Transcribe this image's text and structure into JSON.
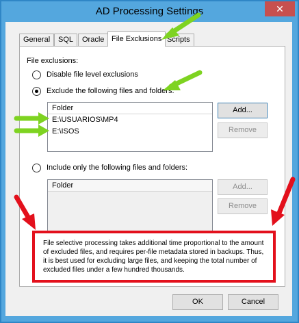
{
  "window": {
    "title": "AD Processing Settings",
    "close_glyph": "✕"
  },
  "tabs": [
    {
      "label": "General"
    },
    {
      "label": "SQL"
    },
    {
      "label": "Oracle"
    },
    {
      "label": "File Exclusions"
    },
    {
      "label": "Scripts"
    }
  ],
  "panel": {
    "group_label": "File exclusions:",
    "option_disable": "Disable file level exclusions",
    "option_exclude": "Exclude the following files and folders:",
    "option_include": "Include only the following files and folders:",
    "selected_option": "exclude",
    "exclude_list": {
      "header": "Folder",
      "rows": [
        "E:\\USUARIOS\\MP4",
        "E:\\ISOS"
      ]
    },
    "include_list": {
      "header": "Folder"
    },
    "add_label": "Add...",
    "remove_label": "Remove"
  },
  "note": "File selective processing takes additional time proportional to the amount of excluded files, and requires per-file metadata stored in backups. Thus, it is best used for excluding large files, and keeping the total number of excluded files under a few hundred thousands.",
  "footer": {
    "ok_label": "OK",
    "cancel_label": "Cancel"
  },
  "colors": {
    "title_bar": "#54a7de",
    "close_button": "#c7504f",
    "annotation_green": "#7ed321",
    "annotation_red": "#e3101c"
  }
}
